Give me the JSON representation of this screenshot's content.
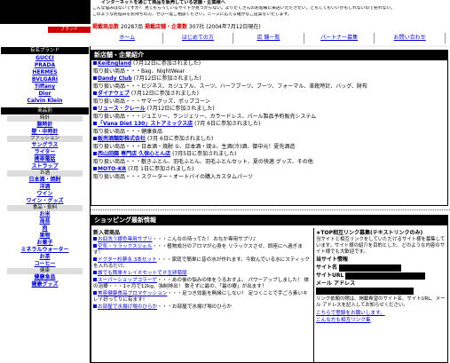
{
  "header": {
    "line1": "インターネットを通じて商品を販売している店舗・企業様へ",
    "line2": "こんな悩みはないですか？ 見てもらっているサイトが見つからない。よりたくさんのお客様に来店いただきたい。どもしてもいいかもしれないので売れない。",
    "line3": "このようなお悩みをお持ちの方、ぜひ一度ご相談ください。ニーズに応える確かなご提案をいたします。",
    "stats": {
      "label_items": "掲載商品数",
      "items": "20287品",
      "label_shops": "掲載店舗・企業数",
      "shops": "307社",
      "date": "(2004年7月12日現在)"
    },
    "logo_tag": "ブランド"
  },
  "nav": [
    "ホーム",
    "はじめての方",
    "店 舗一覧",
    "パートナー募集",
    "お問い合わせ"
  ],
  "sidebar": {
    "brands_head": "有名ブランド",
    "brands": [
      "GUCCI",
      "PRADA",
      "HERMES",
      "BVLGARI",
      "Tiffany",
      "Dior",
      "Calvin Klein"
    ],
    "category_head": "商品別",
    "groups": [
      {
        "head": "時計",
        "items": [
          "腕時計",
          "壁・中時計"
        ]
      },
      {
        "head": "ファッション",
        "items": [
          "サングラス",
          "ライター",
          "携帯電話",
          "ストラップ"
        ]
      },
      {
        "head": "お酒",
        "items": [
          "日本酒・焼酎",
          "洋酒",
          "ワイン",
          "ワイン・グッズ"
        ]
      },
      {
        "head": "食品・飲料",
        "items": [
          "お米",
          "海苔",
          "肉",
          "果物",
          "お菓子",
          "ミネラルウォーター",
          "お茶",
          "コーヒー"
        ]
      },
      {
        "head": "健康",
        "items": [
          "健康食品",
          "健康グッズ"
        ]
      }
    ]
  },
  "panel1": {
    "title": "新店舗・企業紹介",
    "rows": [
      {
        "shop": "KeiEngland",
        "date": "(7月12日に参加されました)",
        "desc": "取り扱い商品・・・Bag、NightWear"
      },
      {
        "shop": "Dandy Club",
        "date": "(7月12日に参加されました)",
        "desc": "取り扱い商品・・・ビジネス、カジュアル、スーツ、ハーフブーツ、ブーツ、フォーマル、革靴時計、バッグ、財布"
      },
      {
        "shop": "ダイナウェブ",
        "date": "(7月12日に参加されました)",
        "desc": "取り扱い商品・・・サマーグッズ、ポップコーン"
      },
      {
        "shop": "リュース・クレール",
        "date": "(7月12日に参加されました)",
        "desc": "取り扱い商品・・・ジュエリー、ランジェリー、カラードレス、パール製品予約販売システム"
      },
      {
        "shop": "「Vana Diet 130」ストアミックス店",
        "date": "(7月 6日に参加されました)",
        "desc": "取り扱い商品・・・健康食品"
      },
      {
        "shop": "販売酒類卸株式会社",
        "date": "(7月 6日に参加されました)",
        "desc": "取り扱い商品・・・日本酒・焼酎 ①、日本酒・焼②、生酒(冷)酒、御中元！夏先酒造"
      },
      {
        "shop": "西山田園 専門店 久保心とん店",
        "date": "(7月5日に参加されました)",
        "desc": "取り扱い商品・・・敷きふとん、羽毛ふとん、羽毛ふとんセット、夏の快適 グッズ、その他"
      },
      {
        "shop": "MOTO-KR",
        "date": "(7月 1日に参加されました)",
        "desc": "取り扱い商品・・・スクーター・オートバイの購入カスタムパーツ"
      }
    ]
  },
  "panel2": {
    "title": "ショッピング最新情報",
    "new_title": "新入荷商品",
    "items": [
      {
        "link": "お皿洗う銀色専用サプリ",
        "text": "・・・こんなの待ってた！ おなか専用サプリ♪"
      },
      {
        "link": "空気・リラックスジェル",
        "text": "・・・植物成分のアロマが心身を リラックスさせ、即座にへ過ぎます！"
      },
      {
        "link": "ドクター杉夢永 3本セット",
        "text": "・・・家庭で簡単に昔の水が作れます。今飲んでいる水にスティックを入れるだけ。"
      },
      {
        "link": "誰でも簡単キレイ＃セットで＃生卵菊版",
        "text": ""
      },
      {
        "link": "スーパーショップコラーゲ",
        "text": "・・・あの後の悩みの体をうるおすよ。 パワーアップしました！ 体の治療・・・1ヶ月で12kg、強制排出！ 数そずに最の、「最の療」が出ます！"
      },
      {
        "link": "美容健康食品プロマケッション",
        "text": "・・・足つき効能を無縁にしない！ 足つくことで手ごろ素いキレイ好ってりに有ます！"
      },
      {
        "link": "お部屋で水揚げ場のひらか",
        "text": "・・・お部屋で水揚げ場のひらか"
      }
    ],
    "right": {
      "title": "★TOP相互リンク募集(テキストリンクのみ)",
      "desc": "当サイトと相互リンクをしていただけるサイト様を募集しています。サイト様の紹介を目的とした、どのような内容のサイト様でも大歓迎です。",
      "site_label": "当サイト情報",
      "site_name_label": "サイト名",
      "site_url_label": "サイトURL",
      "mail_label": "メール アドレス",
      "note": "リンク依頼の際は、掲載希望のサイト名、サイトURL、メール アドレスを記入してお知らせください。",
      "link_text": "こちらで登録をお願いします。",
      "partner_link": "こんな方も相互リンク集"
    }
  }
}
